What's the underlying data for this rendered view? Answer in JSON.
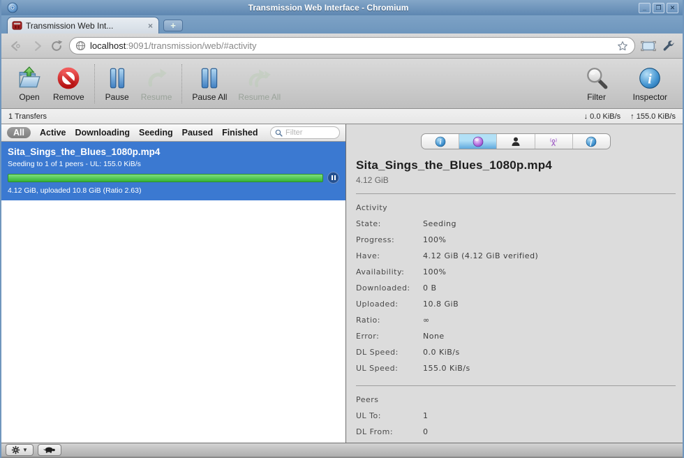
{
  "window": {
    "title": "Transmission Web Interface - Chromium",
    "minimize": "_",
    "maximize": "❐",
    "close": "✕"
  },
  "browser": {
    "tab_title": "Transmission Web Int...",
    "tab_close": "×",
    "new_tab": "+",
    "url_host": "localhost",
    "url_rest": ":9091/transmission/web/#activity"
  },
  "toolbar": {
    "open": "Open",
    "remove": "Remove",
    "pause": "Pause",
    "resume": "Resume",
    "pause_all": "Pause All",
    "resume_all": "Resume All",
    "filter": "Filter",
    "inspector": "Inspector"
  },
  "countbar": {
    "transfers": "1 Transfers",
    "down_arrow": "↓",
    "down_speed": "0.0 KiB/s",
    "up_arrow": "↑",
    "up_speed": "155.0 KiB/s"
  },
  "filterbar": {
    "items": [
      "All",
      "Active",
      "Downloading",
      "Seeding",
      "Paused",
      "Finished"
    ],
    "selected": "All",
    "search_placeholder": "Filter"
  },
  "torrent": {
    "name": "Sita_Sings_the_Blues_1080p.mp4",
    "status": "Seeding to 1 of 1 peers - UL: 155.0 KiB/s",
    "progress_percent": 100,
    "details": "4.12 GiB, uploaded 10.8 GiB (Ratio 2.63)"
  },
  "inspector": {
    "tabs": [
      "info",
      "activity",
      "peers",
      "trackers",
      "files"
    ],
    "selected_tab": "activity",
    "title": "Sita_Sings_the_Blues_1080p.mp4",
    "size": "4.12 GiB",
    "activity": {
      "heading": "Activity",
      "rows": [
        {
          "label": "State:",
          "value": "Seeding"
        },
        {
          "label": "Progress:",
          "value": "100%"
        },
        {
          "label": "Have:",
          "value": "4.12 GiB (4.12 GiB verified)"
        },
        {
          "label": "Availability:",
          "value": "100%"
        },
        {
          "label": "Downloaded:",
          "value": "0 B"
        },
        {
          "label": "Uploaded:",
          "value": "10.8 GiB"
        },
        {
          "label": "Ratio:",
          "value": "∞"
        },
        {
          "label": "Error:",
          "value": "None"
        },
        {
          "label": "DL Speed:",
          "value": "0.0 KiB/s"
        },
        {
          "label": "UL Speed:",
          "value": "155.0 KiB/s"
        }
      ]
    },
    "peers": {
      "heading": "Peers",
      "rows": [
        {
          "label": "UL To:",
          "value": "1"
        },
        {
          "label": "DL From:",
          "value": "0"
        }
      ]
    }
  },
  "colors": {
    "titlebar_blue": "#6e96bd",
    "selection_blue": "#3b79d1",
    "progress_green": "#35b435",
    "inspector_tab_blue": "#5fa9de",
    "panel_gray": "#dcdcdc"
  }
}
